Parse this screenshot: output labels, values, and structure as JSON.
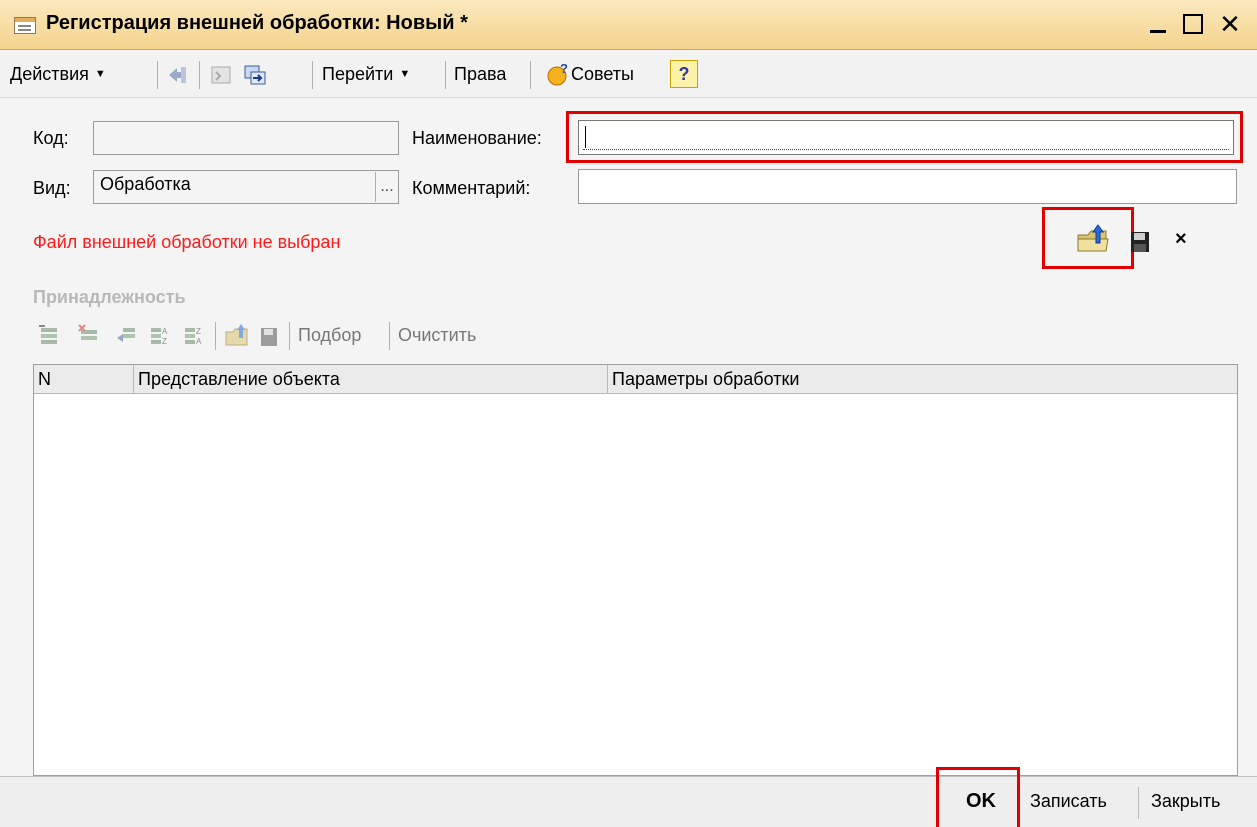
{
  "window": {
    "title": "Регистрация внешней обработки: Новый *"
  },
  "toolbar": {
    "actions": "Действия",
    "goto": "Перейти",
    "rights": "Права",
    "tips": "Советы",
    "help": "?"
  },
  "form": {
    "code_label": "Код:",
    "code_value": "",
    "name_label": "Наименование:",
    "name_value": "",
    "kind_label": "Вид:",
    "kind_value": "Обработка",
    "kind_button": "...",
    "comment_label": "Комментарий:",
    "comment_value": "",
    "file_status": "Файл внешней обработки не выбран"
  },
  "membership": {
    "title": "Принадлежность",
    "pick": "Подбор",
    "clear": "Очистить",
    "columns": [
      "N",
      "Представление объекта",
      "Параметры обработки"
    ],
    "rows": []
  },
  "footer": {
    "ok": "OK",
    "save": "Записать",
    "close": "Закрыть"
  },
  "colors": {
    "highlight": "#e00000",
    "error_text": "#ff1a1a"
  }
}
